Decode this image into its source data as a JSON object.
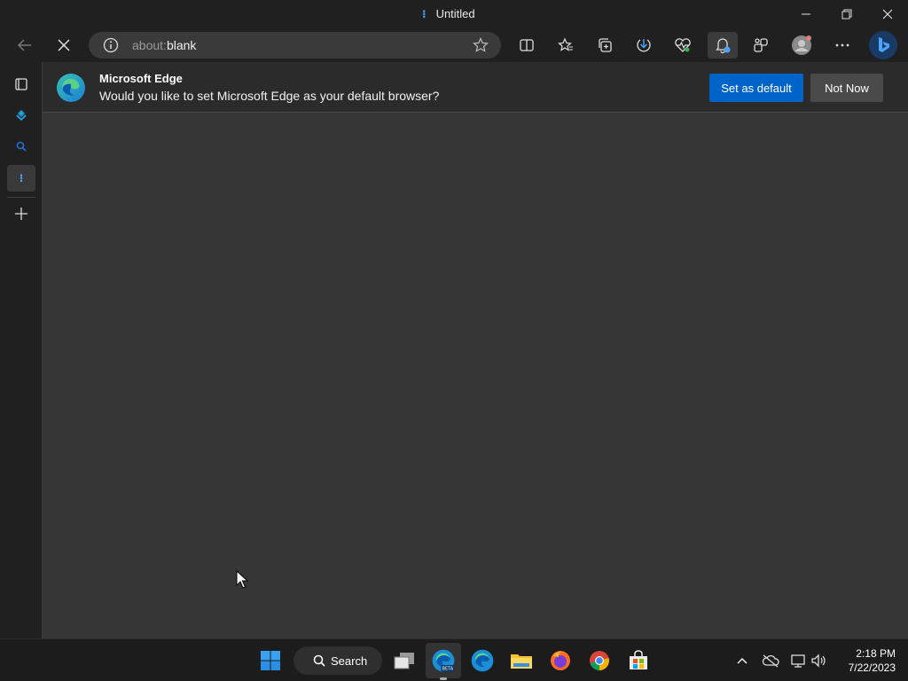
{
  "window": {
    "tab_title": "Untitled",
    "tab_indicator": "⁝"
  },
  "address_bar": {
    "url_prefix": "about:",
    "url_main": "blank"
  },
  "infobar": {
    "title": "Microsoft Edge",
    "message": "Would you like to set Microsoft Edge as your default browser?",
    "primary_button": "Set as default",
    "secondary_button": "Not Now"
  },
  "sidebar": {
    "active_item": "⁝"
  },
  "taskbar": {
    "search_label": "Search",
    "beta_badge": "BETA",
    "time": "2:18 PM",
    "date": "7/22/2023"
  },
  "colors": {
    "accent": "#0063c8",
    "content_bg": "#363636",
    "chrome_bg": "#202020"
  }
}
